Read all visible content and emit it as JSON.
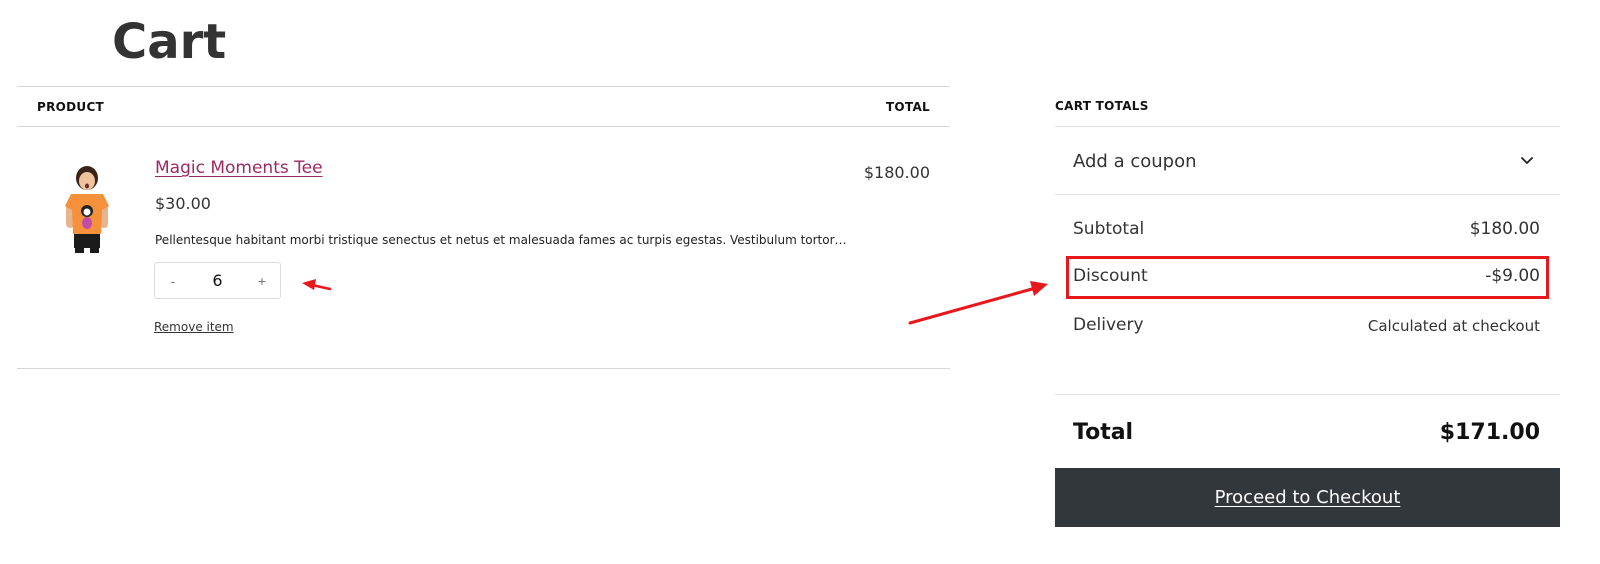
{
  "page": {
    "title": "Cart"
  },
  "cart_table": {
    "header": {
      "product": "PRODUCT",
      "total": "TOTAL"
    },
    "items": [
      {
        "name": "Magic Moments Tee",
        "price": "$30.00",
        "description": "Pellentesque habitant morbi tristique senectus et netus et malesuada fames ac turpis egestas. Vestibulum tortor…",
        "quantity": "6",
        "decrement": "-",
        "increment": "+",
        "remove_label": "Remove item",
        "line_total": "$180.00"
      }
    ]
  },
  "totals": {
    "heading": "CART TOTALS",
    "coupon_label": "Add a coupon",
    "subtotal_label": "Subtotal",
    "subtotal_value": "$180.00",
    "discount_label": "Discount",
    "discount_value": "-$9.00",
    "delivery_label": "Delivery",
    "delivery_value": "Calculated at checkout",
    "total_label": "Total",
    "total_value": "$171.00",
    "checkout_label": "Proceed to Checkout"
  },
  "colors": {
    "product_link": "#9b2a63",
    "checkout_button": "#32373c",
    "annotation_red": "#e8171c"
  },
  "icons": {
    "coupon_toggle": "chevron-down-icon",
    "product_thumbnail": "product-image"
  }
}
